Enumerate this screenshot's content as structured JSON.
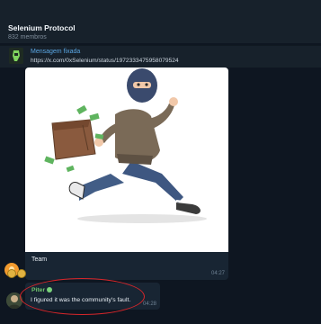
{
  "chat": {
    "title": "Selenium Protocol",
    "members": "832 membros"
  },
  "pinned": {
    "label": "Mensagem fixada",
    "url": "https://x.com/0xSelenium/status/1972333475958079524"
  },
  "message": {
    "caption": "Team",
    "time": "04:27"
  },
  "reply": {
    "author": "Piter",
    "text": "I figured it was the community's fault.",
    "time": "04:28"
  },
  "colors": {
    "background": "#0e1621",
    "header": "#17212b",
    "bubble": "#182533",
    "link": "#5aa6e3",
    "author": "#6fc36b",
    "annotation": "#d8262a"
  },
  "icons": [
    "pinned-thumbnail-icon",
    "thief-illustration",
    "reaction-emoji",
    "verified-badge-icon"
  ]
}
